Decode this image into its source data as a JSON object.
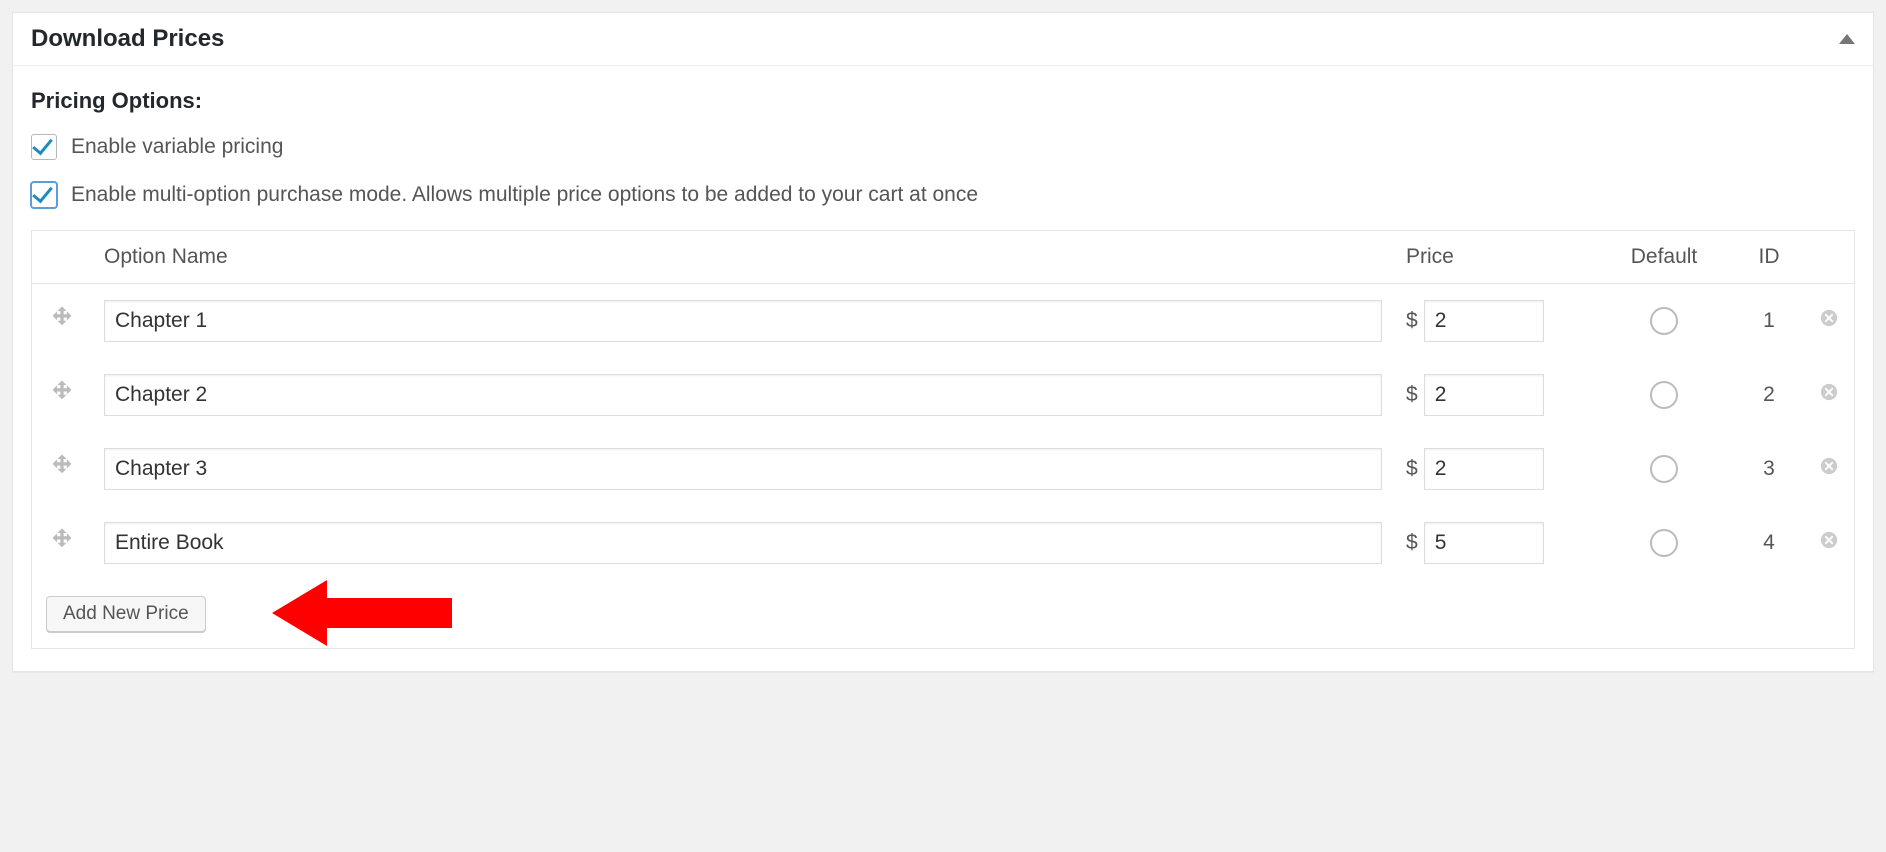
{
  "panel": {
    "title": "Download Prices"
  },
  "pricing": {
    "heading": "Pricing Options:",
    "enable_variable_label": "Enable variable pricing",
    "enable_multi_label": "Enable multi-option purchase mode. Allows multiple price options to be added to your cart at once",
    "enable_variable_checked": true,
    "enable_multi_checked": true
  },
  "table": {
    "headers": {
      "option_name": "Option Name",
      "price": "Price",
      "default": "Default",
      "id": "ID"
    },
    "currency_symbol": "$",
    "rows": [
      {
        "name": "Chapter 1",
        "price": "2",
        "default": false,
        "id": "1"
      },
      {
        "name": "Chapter 2",
        "price": "2",
        "default": false,
        "id": "2"
      },
      {
        "name": "Chapter 3",
        "price": "2",
        "default": false,
        "id": "3"
      },
      {
        "name": "Entire Book",
        "price": "5",
        "default": false,
        "id": "4"
      }
    ],
    "add_button_label": "Add New Price"
  },
  "annotation": {
    "arrow_color": "#ff0000"
  }
}
